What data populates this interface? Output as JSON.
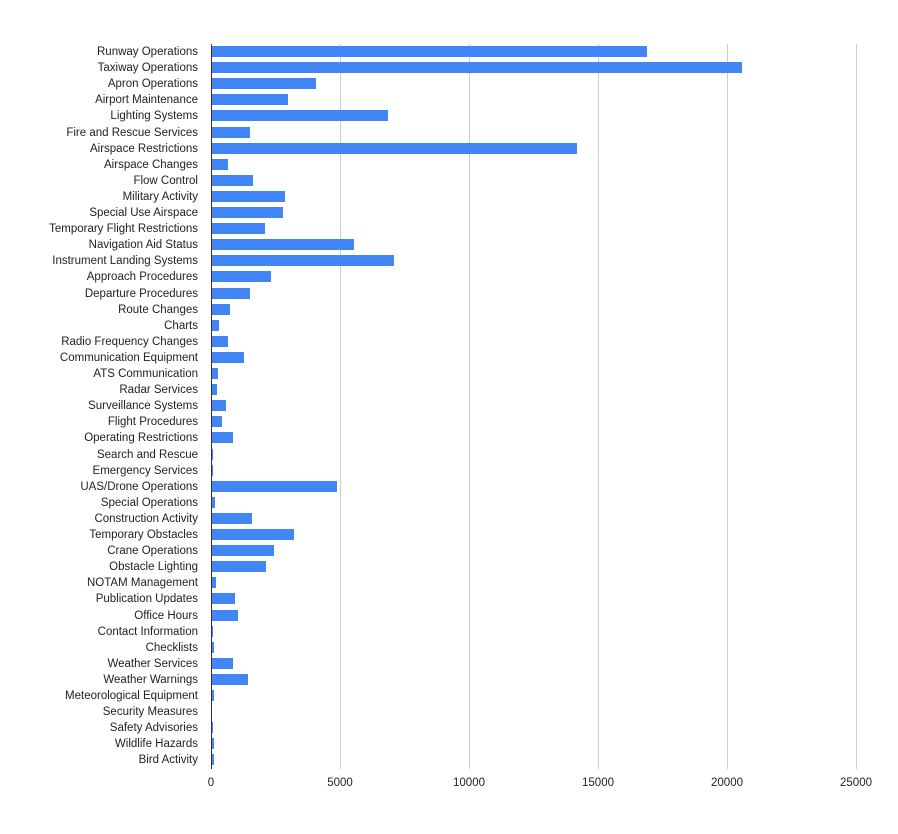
{
  "chart_data": {
    "type": "bar",
    "orientation": "horizontal",
    "title": "",
    "subtitle": "",
    "xlabel": "",
    "ylabel": "",
    "xlim": [
      0,
      25000
    ],
    "ylim": null,
    "grid": true,
    "legend": null,
    "legend_position": "none",
    "xticks": [
      "0",
      "5000",
      "10000",
      "15000",
      "20000",
      "25000"
    ],
    "xtick_values": [
      0,
      5000,
      10000,
      15000,
      20000,
      25000
    ],
    "series_color": "#4285f4",
    "axis_color": "#333333",
    "gridline_color": "#cccccc",
    "categories": [
      "Runway Operations",
      "Taxiway Operations",
      "Apron Operations",
      "Airport Maintenance",
      "Lighting Systems",
      "Fire and Rescue Services",
      "Airspace Restrictions",
      "Airspace Changes",
      "Flow Control",
      "Military Activity",
      "Special Use Airspace",
      "Temporary Flight Restrictions",
      "Navigation Aid Status",
      "Instrument Landing Systems",
      "Approach Procedures",
      "Departure Procedures",
      "Route Changes",
      "Charts",
      "Radio Frequency Changes",
      "Communication Equipment",
      "ATS Communication",
      "Radar Services",
      "Surveillance Systems",
      "Flight Procedures",
      "Operating Restrictions",
      "Search and Rescue",
      "Emergency Services",
      "UAS/Drone Operations",
      "Special Operations",
      "Construction Activity",
      "Temporary Obstacles",
      "Crane Operations",
      "Obstacle Lighting",
      "NOTAM Management",
      "Publication Updates",
      "Office Hours",
      "Contact Information",
      "Checklists",
      "Weather Services",
      "Weather Warnings",
      "Meteorological Equipment",
      "Security Measures",
      "Safety Advisories",
      "Wildlife Hazards",
      "Bird Activity"
    ],
    "values": [
      16900,
      20600,
      4070,
      2985,
      6860,
      1510,
      14200,
      660,
      1630,
      2870,
      2790,
      2090,
      5540,
      7090,
      2325,
      1510,
      730,
      310,
      660,
      1280,
      270,
      230,
      580,
      425,
      850,
      80,
      80,
      4880,
      155,
      1590,
      3220,
      2440,
      2130,
      195,
      930,
      1050,
      80,
      120,
      850,
      1430,
      120,
      20,
      80,
      120,
      120
    ]
  }
}
